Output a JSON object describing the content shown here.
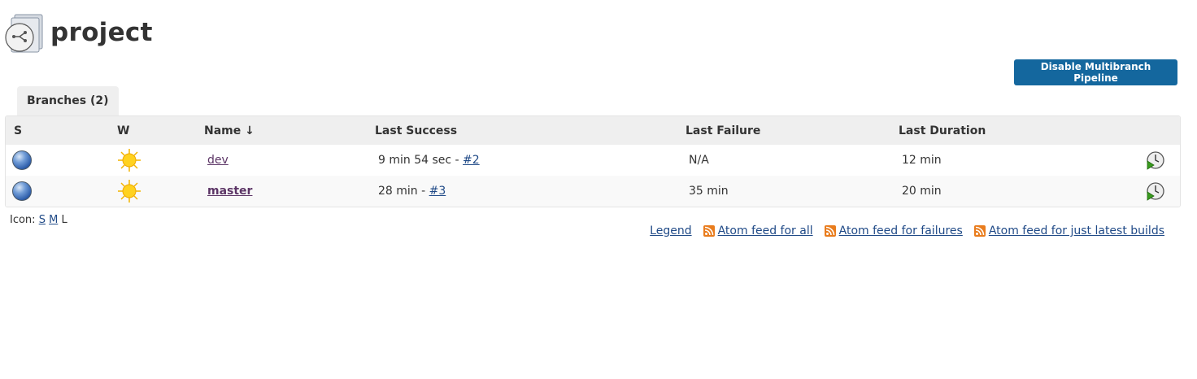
{
  "header": {
    "title": "project",
    "disable_button_label": "Disable Multibranch Pipeline"
  },
  "tabs": [
    {
      "label": "Branches (2)"
    }
  ],
  "table": {
    "columns": [
      "S",
      "W",
      "Name ↓",
      "Last Success",
      "Last Failure",
      "Last Duration"
    ],
    "rows": [
      {
        "status_icon": "blue-ball-icon",
        "weather_icon": "sunny-icon",
        "name": "dev",
        "last_success_text": "9 min 54 sec - ",
        "last_success_build": "#2",
        "last_failure": "N/A",
        "last_duration": "12 min",
        "action_icon": "schedule-build-icon"
      },
      {
        "status_icon": "blue-ball-icon",
        "weather_icon": "sunny-icon",
        "name": "master",
        "last_success_text": "28 min - ",
        "last_success_build": "#3",
        "last_failure": "35 min",
        "last_duration": "20 min",
        "action_icon": "schedule-build-icon"
      }
    ]
  },
  "icon_size": {
    "label": "Icon: ",
    "small": "S",
    "medium": "M",
    "large": "L"
  },
  "footer": {
    "legend": "Legend",
    "feed_all": "Atom feed for all",
    "feed_failures": "Atom feed for failures",
    "feed_latest": "Atom feed for just latest builds"
  },
  "colors": {
    "button_bg": "#14679e",
    "link": "#204a87",
    "visited_link": "#5c3566",
    "feed_orange": "#e97c1d"
  }
}
